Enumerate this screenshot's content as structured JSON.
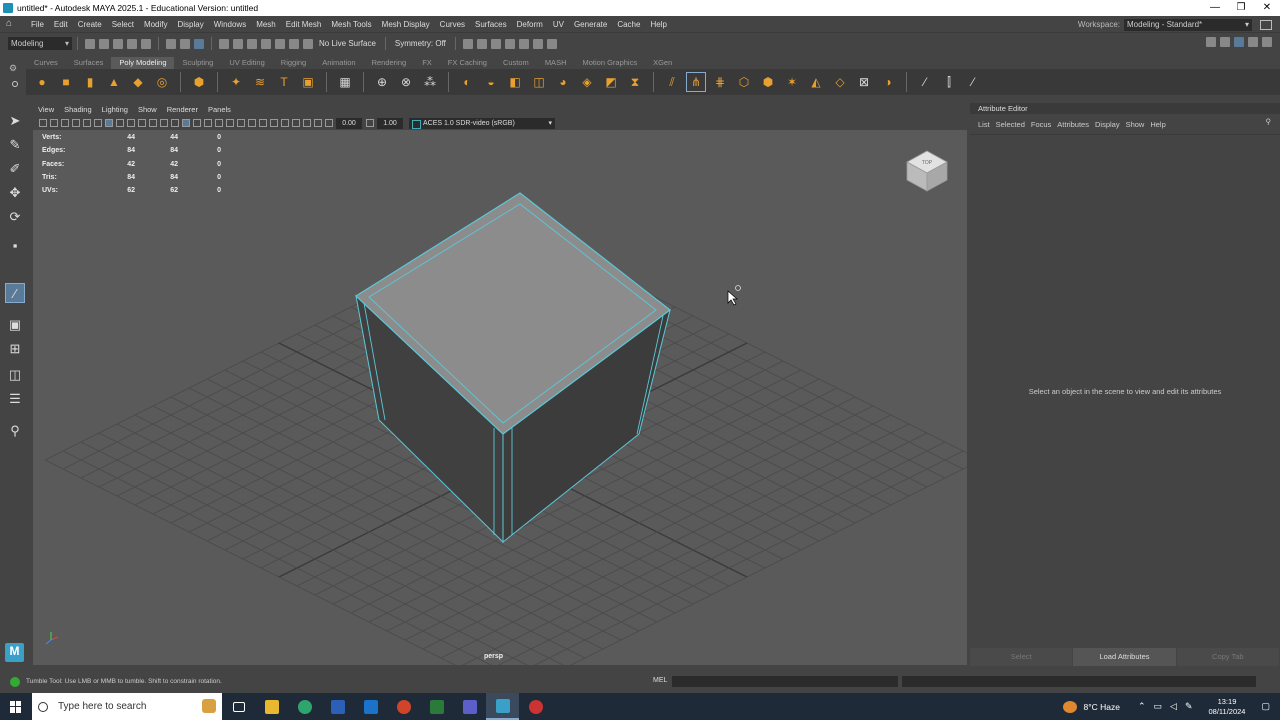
{
  "window": {
    "title": "untitled* - Autodesk MAYA 2025.1 - Educational Version: untitled",
    "min": "—",
    "max": "❐",
    "close": "✕"
  },
  "menubar": {
    "items": [
      "File",
      "Edit",
      "Create",
      "Select",
      "Modify",
      "Display",
      "Windows",
      "Mesh",
      "Edit Mesh",
      "Mesh Tools",
      "Mesh Display",
      "Curves",
      "Surfaces",
      "Deform",
      "UV",
      "Generate",
      "Cache",
      "Help"
    ],
    "workspace_label": "Workspace:",
    "workspace_value": "Modeling - Standard*"
  },
  "statusline": {
    "mode": "Modeling",
    "live_surface": "No Live Surface",
    "symmetry": "Symmetry: Off"
  },
  "shelf": {
    "tabs": [
      "Curves",
      "Surfaces",
      "Poly Modeling",
      "Sculpting",
      "UV Editing",
      "Rigging",
      "Animation",
      "Rendering",
      "FX",
      "FX Caching",
      "Custom",
      "MASH",
      "Motion Graphics",
      "XGen"
    ],
    "active_tab": "Poly Modeling"
  },
  "viewport": {
    "menu": [
      "View",
      "Shading",
      "Lighting",
      "Show",
      "Renderer",
      "Panels"
    ],
    "exposure": "0.00",
    "gamma": "1.00",
    "colorspace": "ACES 1.0 SDR-video (sRGB)",
    "hud": [
      {
        "label": "Verts:",
        "a": "44",
        "b": "44",
        "c": "0"
      },
      {
        "label": "Edges:",
        "a": "84",
        "b": "84",
        "c": "0"
      },
      {
        "label": "Faces:",
        "a": "42",
        "b": "42",
        "c": "0"
      },
      {
        "label": "Tris:",
        "a": "84",
        "b": "84",
        "c": "0"
      },
      {
        "label": "UVs:",
        "a": "62",
        "b": "62",
        "c": "0"
      }
    ],
    "camera": "persp",
    "viewcube_label": "TOP"
  },
  "attribute_editor": {
    "title": "Attribute Editor",
    "menu": [
      "List",
      "Selected",
      "Focus",
      "Attributes",
      "Display",
      "Show",
      "Help"
    ],
    "message": "Select an object in the scene to view and edit its attributes",
    "footer": [
      "Select",
      "Load Attributes",
      "Copy Tab"
    ]
  },
  "helpline": {
    "text": "Tumble Tool: Use LMB or MMB to tumble. Shift to constrain rotation.",
    "mel": "MEL"
  },
  "taskbar": {
    "search_placeholder": "Type here to search",
    "weather": "8°C  Haze",
    "time": "13:19",
    "date": "08/11/2024"
  },
  "colors": {
    "accent": "#5bc8d8",
    "viewport_bg": "#5a5a5a",
    "shelf_icon": "#e8a030"
  }
}
